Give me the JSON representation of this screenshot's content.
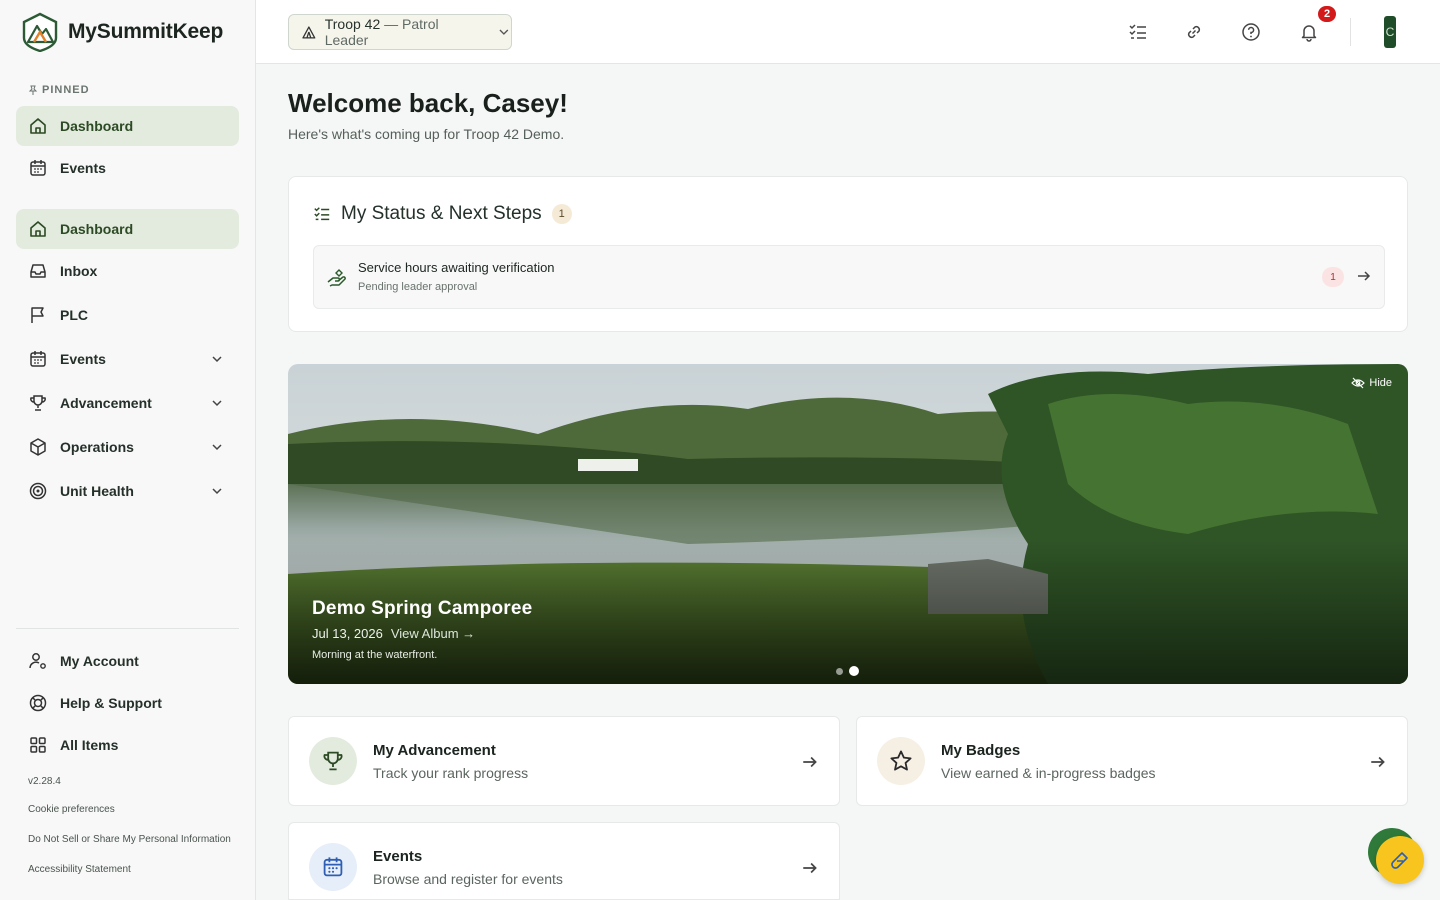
{
  "brand": {
    "name": "MySummitKeep"
  },
  "sidebar": {
    "pinned_label": "PINNED",
    "pinned": [
      {
        "label": "Dashboard",
        "icon": "home-icon",
        "active": true
      },
      {
        "label": "Events",
        "icon": "calendar-icon",
        "active": false
      }
    ],
    "items": [
      {
        "label": "Dashboard",
        "icon": "home-icon",
        "active": true,
        "expandable": false
      },
      {
        "label": "Inbox",
        "icon": "inbox-icon",
        "active": false,
        "expandable": false
      },
      {
        "label": "PLC",
        "icon": "flag-icon",
        "active": false,
        "expandable": false
      },
      {
        "label": "Events",
        "icon": "calendar-icon",
        "active": false,
        "expandable": true
      },
      {
        "label": "Advancement",
        "icon": "trophy-icon",
        "active": false,
        "expandable": true
      },
      {
        "label": "Operations",
        "icon": "box-icon",
        "active": false,
        "expandable": true
      },
      {
        "label": "Unit Health",
        "icon": "target-icon",
        "active": false,
        "expandable": true
      }
    ],
    "bottom": [
      {
        "label": "My Account",
        "icon": "user-gear-icon"
      },
      {
        "label": "Help & Support",
        "icon": "lifebuoy-icon"
      },
      {
        "label": "All Items",
        "icon": "grid-icon"
      }
    ],
    "version": "v2.28.4",
    "footer_links": [
      "Cookie preferences",
      "Do Not Sell or Share My Personal Information",
      "Accessibility Statement"
    ]
  },
  "topbar": {
    "troop_name": "Troop 42",
    "troop_role": " — Patrol Leader",
    "notification_count": "2",
    "avatar_initial": "C"
  },
  "main": {
    "welcome": "Welcome back, Casey!",
    "subtitle": "Here's what's coming up for Troop 42 Demo.",
    "status": {
      "title": "My Status & Next Steps",
      "count": "1",
      "row_title": "Service hours awaiting verification",
      "row_subtitle": "Pending leader approval",
      "row_count": "1"
    },
    "hero": {
      "hide_label": "Hide",
      "title": "Demo Spring Camporee",
      "date": "Jul 13, 2026",
      "album_link": "View Album →",
      "caption": "Morning at the waterfront."
    },
    "quick": [
      {
        "title": "My Advancement",
        "subtitle": "Track your rank progress",
        "icon": "trophy-icon"
      },
      {
        "title": "My Badges",
        "subtitle": "View earned & in-progress badges",
        "icon": "star-icon"
      },
      {
        "title": "Events",
        "subtitle": "Browse and register for events",
        "icon": "calendar-icon"
      }
    ]
  },
  "colors": {
    "accent": "#2c4a24",
    "active_bg": "#e3ebde",
    "badge_red": "#d31a1a",
    "fab": "#f7c51e"
  }
}
